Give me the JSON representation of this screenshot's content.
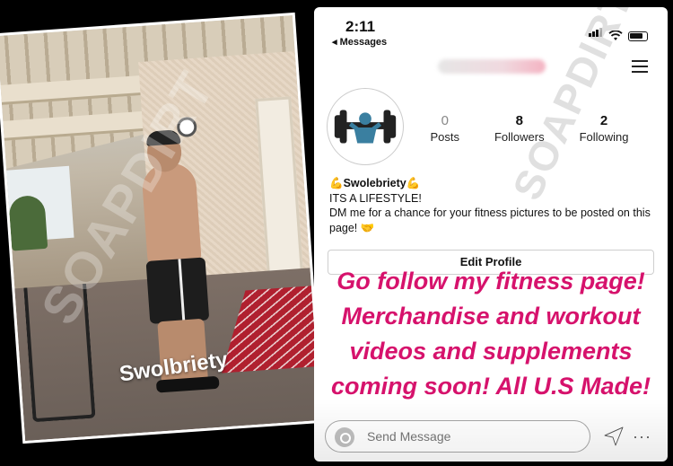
{
  "photo": {
    "caption": "Swolbriety",
    "watermark": "SOAPDIRT"
  },
  "status_bar": {
    "time": "2:11",
    "back_label": "◂ Messages"
  },
  "profile": {
    "username_hidden": true,
    "stats": [
      {
        "value": "0",
        "label": "Posts"
      },
      {
        "value": "8",
        "label": "Followers"
      },
      {
        "value": "2",
        "label": "Following"
      }
    ],
    "display_name": "💪Swolebriety💪",
    "bio_line1": "ITS A LIFESTYLE!",
    "bio_line2": "DM me for a chance for your fitness pictures to be posted on this page! 🤝",
    "edit_profile_label": "Edit Profile"
  },
  "story_overlay": {
    "text": "Go follow my fitness page! Merchandise and workout videos and supplements coming soon! All U.S Made!",
    "color": "#d6126c"
  },
  "reply_bar": {
    "placeholder": "Send Message"
  },
  "watermark_right": "SOAPDIRT",
  "icons": [
    "camera-icon",
    "send-icon",
    "more-icon",
    "menu-icon"
  ]
}
